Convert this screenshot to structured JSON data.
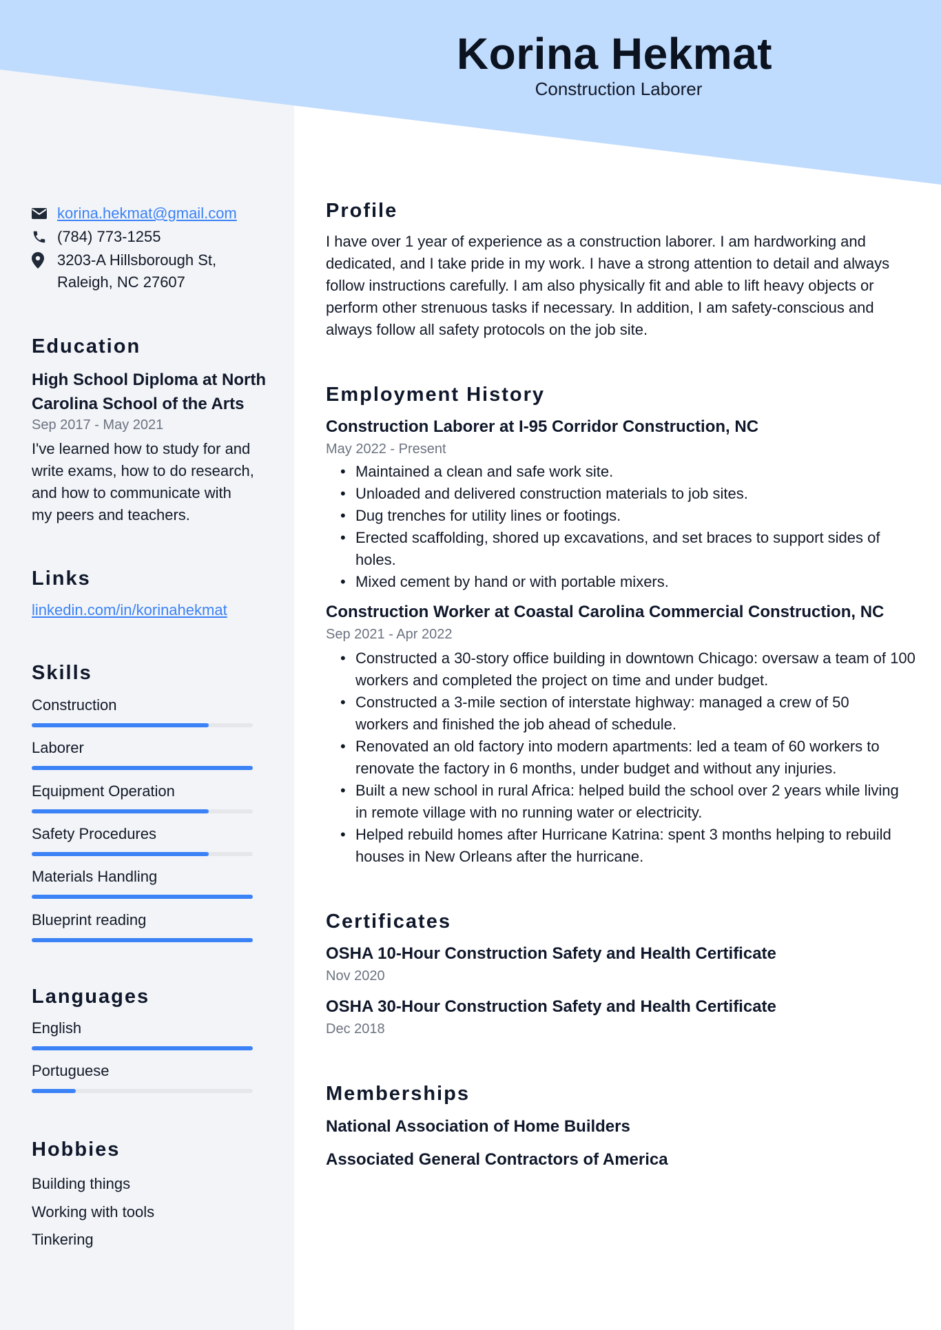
{
  "header": {
    "name": "Korina Hekmat",
    "title": "Construction Laborer"
  },
  "colors": {
    "header_band": "#bfdbfe",
    "sidebar_bg": "#f2f4f7",
    "accent": "#3b82f6",
    "muted": "#6b7280",
    "text": "#111827"
  },
  "contact": {
    "email": {
      "icon": "envelope-icon",
      "value": "korina.hekmat@gmail.com"
    },
    "phone": {
      "icon": "phone-icon",
      "value": "(784) 773-1255"
    },
    "address": {
      "icon": "map-pin-icon",
      "line1": "3203-A Hillsborough St,",
      "line2": "Raleigh, NC 27607"
    }
  },
  "education": {
    "heading": "Education",
    "degree_line1": "High School Diploma at North",
    "degree_line2": "Carolina School of the Arts",
    "dates": "Sep 2017 - May 2021",
    "description": [
      "I've learned how to study for and",
      "write exams, how to do research,",
      "and how to communicate with",
      "my peers and teachers."
    ]
  },
  "links": {
    "heading": "Links",
    "items": [
      {
        "label": "linkedin.com/in/korinahekmat"
      }
    ]
  },
  "skills": {
    "heading": "Skills",
    "items": [
      {
        "label": "Construction",
        "level_percent": 80
      },
      {
        "label": "Laborer",
        "level_percent": 100
      },
      {
        "label": "Equipment Operation",
        "level_percent": 80
      },
      {
        "label": "Safety Procedures",
        "level_percent": 80
      },
      {
        "label": "Materials Handling",
        "level_percent": 100
      },
      {
        "label": "Blueprint reading",
        "level_percent": 100
      }
    ]
  },
  "languages": {
    "heading": "Languages",
    "items": [
      {
        "label": "English",
        "level_percent": 100
      },
      {
        "label": "Portuguese",
        "level_percent": 20
      }
    ]
  },
  "hobbies": {
    "heading": "Hobbies",
    "items": [
      "Building things",
      "Working with tools",
      "Tinkering"
    ]
  },
  "profile": {
    "heading": "Profile",
    "lines": [
      "I have over 1 year of experience as a construction laborer. I am hardworking and",
      "dedicated, and I take pride in my work. I have a strong attention to detail and always",
      "follow instructions carefully. I am also physically fit and able to lift heavy objects or",
      "perform other strenuous tasks if necessary. In addition, I am safety-conscious and",
      "always follow all safety protocols on the job site."
    ]
  },
  "employment": {
    "heading": "Employment History",
    "jobs": [
      {
        "title": "Construction Laborer at I-95 Corridor Construction, NC",
        "dates": "May 2022 - Present",
        "bullets": [
          "Maintained a clean and safe work site.",
          "Unloaded and delivered construction materials to job sites.",
          "Dug trenches for utility lines or footings.",
          "Erected scaffolding, shored up excavations, and set braces to support sides of holes.",
          "Mixed cement by hand or with portable mixers."
        ]
      },
      {
        "title": "Construction Worker at Coastal Carolina Commercial Construction, NC",
        "dates": "Sep 2021 - Apr 2022",
        "bullets": [
          "Constructed a 30-story office building in downtown Chicago: oversaw a team of 100 workers and completed the project on time and under budget.",
          "Constructed a 3-mile section of interstate highway: managed a crew of 50 workers and finished the job ahead of schedule.",
          "Renovated an old factory into modern apartments: led a team of 60 workers to renovate the factory in 6 months, under budget and without any injuries.",
          "Built a new school in rural Africa: helped build the school over 2 years while living in remote village with no running water or electricity.",
          "Helped rebuild homes after Hurricane Katrina: spent 3 months helping to rebuild houses in New Orleans after the hurricane."
        ]
      }
    ]
  },
  "certificates": {
    "heading": "Certificates",
    "items": [
      {
        "title": "OSHA 10-Hour Construction Safety and Health Certificate",
        "date": "Nov 2020"
      },
      {
        "title": "OSHA 30-Hour Construction Safety and Health Certificate",
        "date": "Dec 2018"
      }
    ]
  },
  "memberships": {
    "heading": "Memberships",
    "items": [
      "National Association of Home Builders",
      "Associated General Contractors of America"
    ]
  }
}
